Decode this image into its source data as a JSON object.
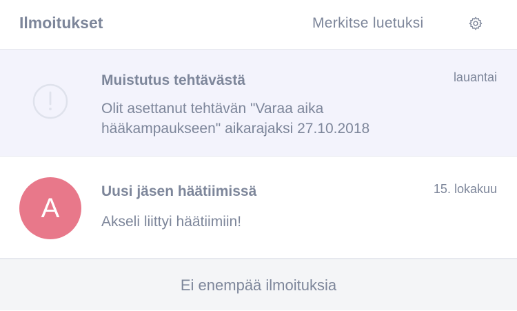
{
  "header": {
    "title": "Ilmoitukset",
    "mark_read_label": "Merkitse luetuksi",
    "settings_icon": "gear-icon"
  },
  "notifications": [
    {
      "icon": "exclamation-circle-icon",
      "title": "Muistutus tehtävästä",
      "date": "lauantai",
      "body": "Olit asettanut tehtävän \"Varaa aika hääkampaukseen\" aikarajaksi 27.10.2018",
      "unread": true
    },
    {
      "avatar_letter": "A",
      "avatar_color": "#e8788a",
      "title": "Uusi jäsen häätiimissä",
      "date": "15. lokakuu",
      "body": "Akseli liittyi häätiimiin!",
      "unread": false
    }
  ],
  "footer": {
    "text": "Ei enempää ilmoituksia"
  },
  "colors": {
    "text": "#7d869a",
    "unread_bg": "#f3f3fc",
    "footer_bg": "#f4f5f7"
  }
}
